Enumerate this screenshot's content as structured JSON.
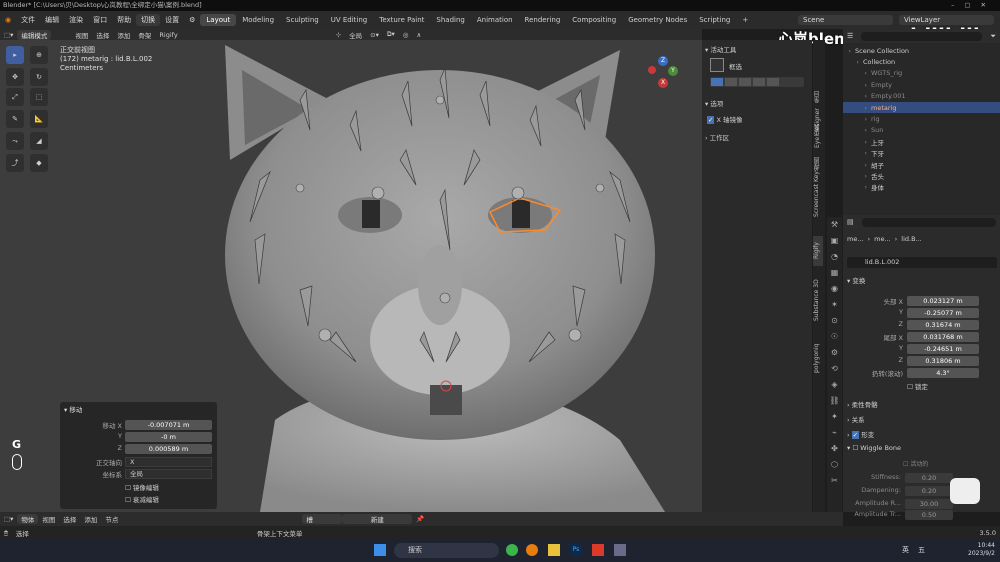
{
  "window": {
    "title": "Blender* [C:\\Users\\贝\\Desktop\\心岚教程\\全绑定小猫\\案例.blend]"
  },
  "topbar": {
    "menus": [
      "文件",
      "编辑",
      "渲染",
      "窗口",
      "帮助"
    ],
    "switch_label": "切换",
    "settings_label": "设置",
    "tabs": [
      "Layout",
      "Modeling",
      "Sculpting",
      "UV Editing",
      "Texture Paint",
      "Shading",
      "Animation",
      "Rendering",
      "Compositing",
      "Geometry Nodes",
      "Scripting"
    ],
    "add_tab": "+",
    "scene": "Scene",
    "view_layer": "ViewLayer"
  },
  "viewport_header": {
    "mode": "编辑模式",
    "menus": [
      "视图",
      "选择",
      "添加",
      "骨架",
      "Rigify"
    ],
    "transform_orientation": "全局"
  },
  "viewport": {
    "view_name": "正交前视图",
    "object_info": "(172) metarig : lid.B.L.002",
    "units": "Centimeters",
    "key_overlay": "G"
  },
  "gizmo": {
    "x": "X",
    "y": "Y",
    "z": "Z"
  },
  "side_panel": {
    "tool_section": "活动工具",
    "tool_label": "框选",
    "options_section": "选项",
    "mirror_label": "X 轴镜像",
    "workspace_section": "工作区",
    "tabs": [
      "条目",
      "工具",
      "视图",
      "Eye Designer",
      "Screencast Keys",
      "Rigify",
      "Substance 3D",
      "polygoniq"
    ]
  },
  "operator_panel": {
    "title": "移动",
    "move_x_label": "移动 X",
    "move_x": "-0.007071 m",
    "move_y_label": "Y",
    "move_y": "-0 m",
    "move_z_label": "Z",
    "move_z": "0.000589 m",
    "axis_label": "正交轴向",
    "axis_value": "X",
    "orient_label": "坐标系",
    "orient_value": "全局",
    "mirror_edit": "镜像编辑",
    "falloff_edit": "衰减编辑"
  },
  "outliner": {
    "search_placeholder": "",
    "rows": [
      {
        "label": "Scene Collection",
        "color": "#cfcfcf"
      },
      {
        "label": "Collection",
        "color": "#cfcfcf"
      },
      {
        "label": "WGTS_rig",
        "color": "#8a8a8a"
      },
      {
        "label": "Empty",
        "color": "#8a8a8a"
      },
      {
        "label": "Empty.001",
        "color": "#8a8a8a"
      },
      {
        "label": "metarig",
        "color": "#ffb07a"
      },
      {
        "label": "rig",
        "color": "#8a8a8a"
      },
      {
        "label": "Sun",
        "color": "#8a8a8a"
      },
      {
        "label": "上牙",
        "color": "#cfcfcf"
      },
      {
        "label": "下牙",
        "color": "#cfcfcf"
      },
      {
        "label": "胡子",
        "color": "#cfcfcf"
      },
      {
        "label": "舌头",
        "color": "#cfcfcf"
      },
      {
        "label": "身体",
        "color": "#cfcfcf"
      }
    ]
  },
  "properties": {
    "breadcrumb": [
      "me...",
      "me...",
      "lid.B..."
    ],
    "bone_name": "lid.B.L.002",
    "transform_title": "变换",
    "head_x_label": "头部 X",
    "head_x": "0.023127 m",
    "head_y_label": "Y",
    "head_y": "-0.25077 m",
    "head_z_label": "Z",
    "head_z": "0.31674 m",
    "tail_x_label": "尾部 X",
    "tail_x": "0.031768 m",
    "tail_y_label": "Y",
    "tail_y": "-0.24651 m",
    "tail_z_label": "Z",
    "tail_z": "0.31806 m",
    "roll_label": "扔转(滚动)",
    "roll": "4.3°",
    "lock_label": "锁定",
    "bendy_label": "柔性骨骼",
    "relations_label": "关系",
    "deform_label": "形变",
    "wiggle_label": "Wiggle Bone",
    "wiggle_active": "活动的",
    "stiffness_label": "Stiffness:",
    "stiffness": "0.20",
    "dampening_label": "Dampening:",
    "dampening": "0.20",
    "amp_r_label": "Amplitude R...",
    "amp_r": "30.00",
    "amp_t_label": "Amplitude Tr...",
    "amp_t": "0.50"
  },
  "bottom_header": {
    "mode": "物体",
    "menus": [
      "视图",
      "选择",
      "添加",
      "节点"
    ],
    "slot_label": "槽",
    "new_label": "新建"
  },
  "status_bar": {
    "left": "选择",
    "middle": "骨架上下文菜单",
    "version": "3.5.0"
  },
  "watermark": {
    "text": "心岚blender"
  },
  "taskbar": {
    "search": "搜索",
    "lang": "英",
    "ime": "五",
    "time": "10:44",
    "date": "2023/9/2"
  },
  "colors": {
    "accent": "#4772b3",
    "select_orange": "#ff8a2a",
    "viewport_bg": "#3d3d3d"
  }
}
